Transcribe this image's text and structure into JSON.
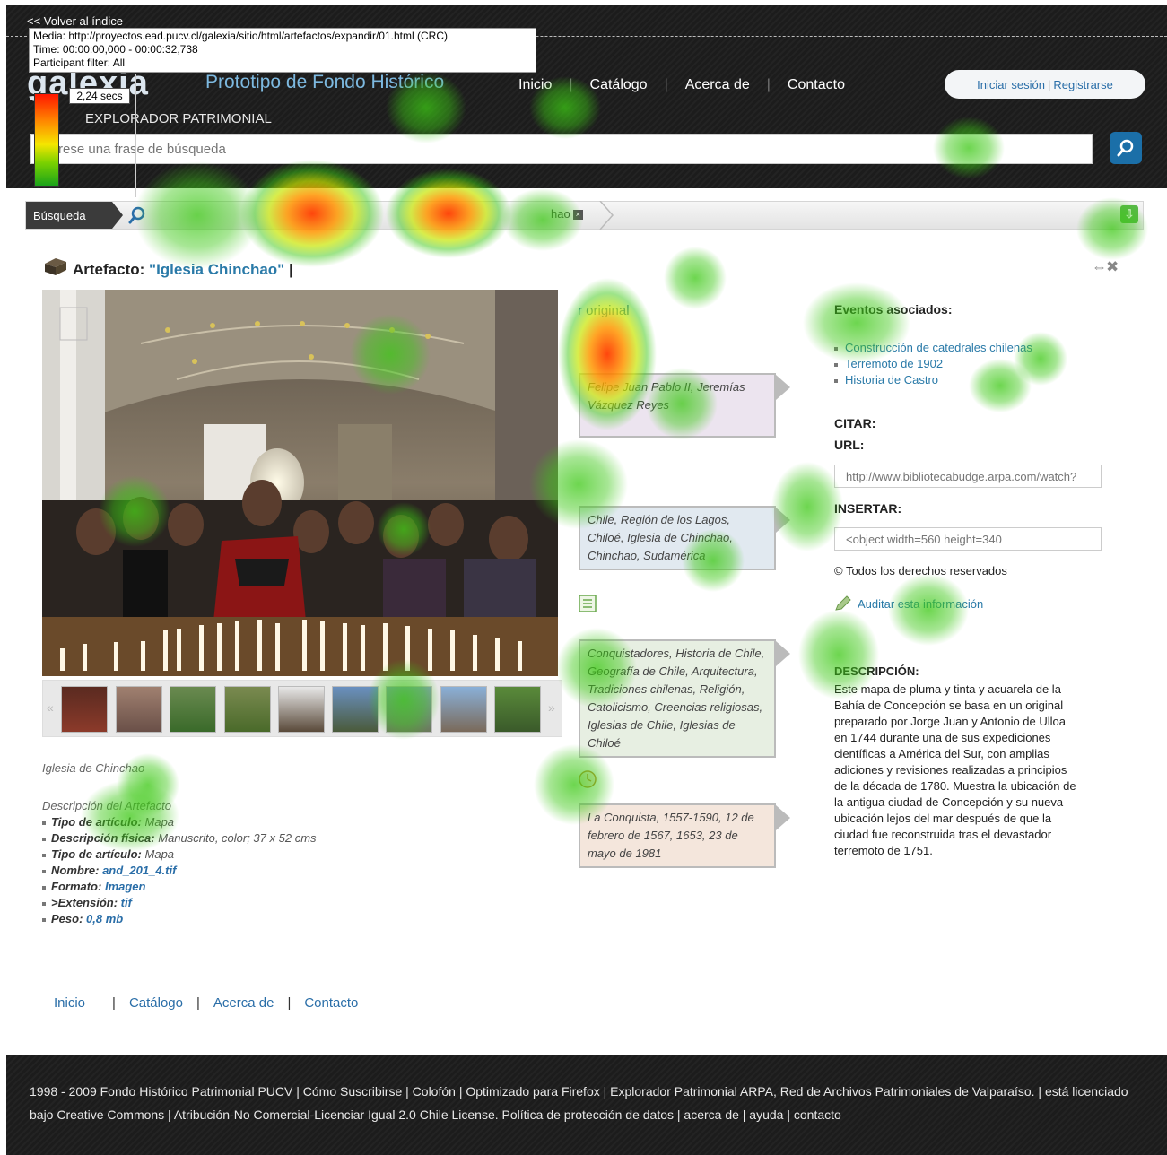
{
  "overlay": {
    "back_link": "<< Volver al índice",
    "media": "Media: http://proyectos.ead.pucv.cl/galexia/sitio/html/artefactos/expandir/01.html (CRC)",
    "time": "Time: 00:00:00,000 - 00:00:32,738",
    "filter": "Participant filter: All",
    "timer": "2,24 secs"
  },
  "header": {
    "logo": "galexia",
    "logo_sub": "EXPLORADOR PATRIMONIAL",
    "site_title": "Prototipo de Fondo Histórico",
    "nav": [
      "Inicio",
      "Catálogo",
      "Acerca de",
      "Contacto"
    ],
    "login": "Iniciar sesión",
    "register": "Registrarse",
    "search_placeholder": "rese una frase de búsqueda"
  },
  "breadcrumb": {
    "first": "Búsqueda",
    "tag": "hao"
  },
  "artifact": {
    "label": "Artefacto: ",
    "title": "\"Iglesia Chinchao\"",
    "caption": "Iglesia de Chinchao",
    "view_original": "r original"
  },
  "details": {
    "heading": "Descripción del Artefacto",
    "rows": [
      {
        "k": "Tipo de artículo:",
        "v": "Mapa",
        "link": false
      },
      {
        "k": "Descripción física:",
        "v": "Manuscrito, color; 37 x 52 cms",
        "link": false
      },
      {
        "k": "Tipo de artículo:",
        "v": "Mapa",
        "link": false
      },
      {
        "k": "Nombre:",
        "v": "and_201_4.tif",
        "link": true
      },
      {
        "k": "Formato:",
        "v": "Imagen",
        "link": true
      },
      {
        "k": ">Extensión:",
        "v": "tif",
        "link": true
      },
      {
        "k": "Peso:",
        "v": "0,8 mb",
        "link": true
      }
    ]
  },
  "tags": {
    "people": "Felipe Juan Pablo II, Jeremías Vázquez Reyes",
    "places": "Chile, Región de los Lagos, Chiloé, Iglesia de Chinchao, Chinchao, Sudamérica",
    "topics": "Conquistadores, Historia de Chile, Geografía de Chile, Arquitectura, Tradiciones chilenas, Religión, Catolicismo, Creencias religiosas, Iglesias de Chile, Iglesias de Chiloé",
    "dates": "La Conquista, 1557-1590, 12 de febrero de 1567, 1653, 23 de mayo de 1981"
  },
  "right": {
    "related_heading": "Eventos asociados:",
    "related": [
      "Construcción de catedrales chilenas",
      "Terremoto de 1902",
      "Historia de Castro"
    ],
    "cite_heading": "CITAR:",
    "url_label": "URL:",
    "url_value": "http://www.bibliotecabudge.arpa.com/watch?",
    "embed_label": "INSERTAR:",
    "embed_value": "<object width=560 height=340",
    "rights": "© Todos los derechos reservados",
    "audit": "Auditar esta información",
    "desc_heading": "DESCRIPCIÓN:",
    "desc": "Este mapa de pluma y tinta y acuarela de la Bahía de Concepción se basa en un original preparado por Jorge Juan y Antonio de Ulloa en 1744 durante una de sus expediciones científicas a América del Sur, con amplias adiciones y revisiones realizadas a principios de la década de 1780. Muestra la ubicación de la antigua ciudad de Concepción y su nueva ubicación lejos del mar después de que la ciudad fue reconstruida tras el devastador terremoto de 1751."
  },
  "footer_nav": [
    "Inicio",
    "Catálogo",
    "Acerca de",
    "Contacto"
  ],
  "footer_text": "1998 - 2009 Fondo Histórico Patrimonial PUCV | Cómo Suscribirse | Colofón | Optimizado para Firefox | Explorador Patrimonial ARPA, Red de Archivos Patrimoniales de Valparaíso. | está licenciado bajo Creative Commons | Atribución-No Comercial-Licenciar Igual 2.0 Chile License. Política de protección de datos | acerca de | ayuda | contacto",
  "colors": {
    "header_bg": "#1c1c1c",
    "link": "#2a6ea8",
    "accent_blue": "#1b6fa8",
    "heat_hot": "#ff3c00",
    "heat_cool": "#3cc814"
  }
}
